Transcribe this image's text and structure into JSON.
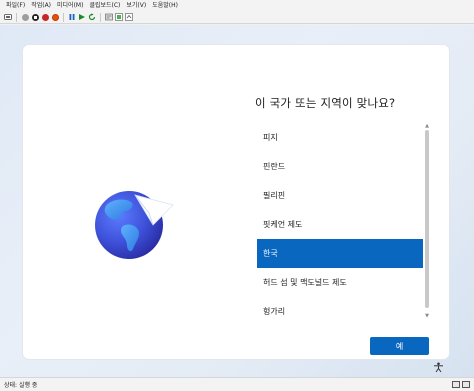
{
  "menubar": {
    "items": [
      {
        "label": "파일(F)"
      },
      {
        "label": "작업(A)"
      },
      {
        "label": "미디어(M)"
      },
      {
        "label": "클립보드(C)"
      },
      {
        "label": "보기(V)"
      },
      {
        "label": "도움말(H)"
      }
    ]
  },
  "toolbar": {
    "buttons": [
      {
        "icon": "ctrl-alt-del-icon"
      },
      {
        "icon": "start-icon"
      },
      {
        "icon": "turn-off-icon"
      },
      {
        "icon": "shutdown-icon"
      },
      {
        "icon": "power-icon"
      },
      {
        "icon": "pause-icon"
      },
      {
        "icon": "reset-icon"
      },
      {
        "icon": "checkpoint-icon"
      },
      {
        "icon": "revert-icon"
      },
      {
        "icon": "enhanced-session-icon"
      },
      {
        "icon": "share-icon"
      }
    ],
    "colors": {
      "start": "#1a8a2a",
      "off": "#c62828",
      "pause": "#1565c0"
    }
  },
  "oobe": {
    "title": "이 국가 또는 지역이 맞나요?",
    "regions": [
      {
        "label": "피지",
        "selected": false
      },
      {
        "label": "핀란드",
        "selected": false
      },
      {
        "label": "필리핀",
        "selected": false
      },
      {
        "label": "핏케언 제도",
        "selected": false
      },
      {
        "label": "한국",
        "selected": true
      },
      {
        "label": "허드 섬 및 맥도널드 제도",
        "selected": false
      },
      {
        "label": "헝가리",
        "selected": false
      }
    ],
    "next_label": "예",
    "accent": "#0a67c0"
  },
  "statusbar": {
    "text": "상태: 실행 중"
  }
}
